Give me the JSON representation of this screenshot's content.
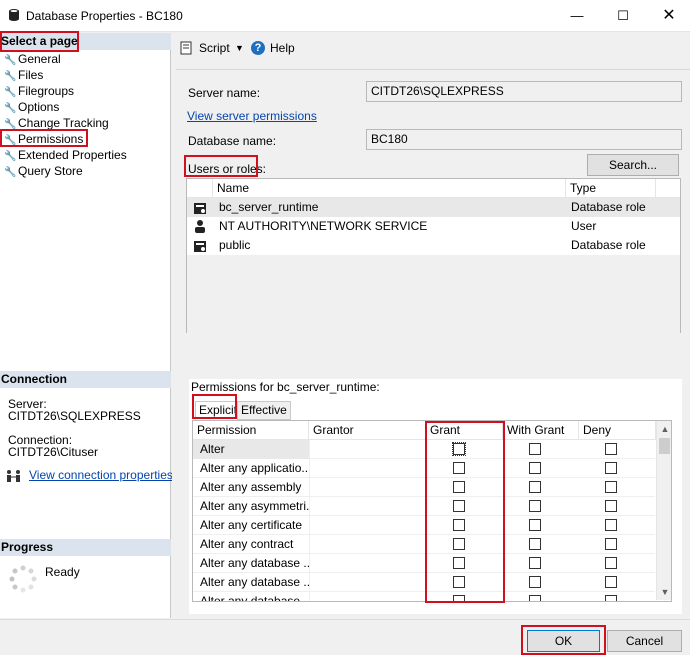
{
  "window": {
    "title": "Database Properties - BC180",
    "minimize": "—",
    "maximize": "☐",
    "close": "✕"
  },
  "left": {
    "select_page": "Select a page",
    "pages": [
      "General",
      "Files",
      "Filegroups",
      "Options",
      "Change Tracking",
      "Permissions",
      "Extended Properties",
      "Query Store"
    ],
    "connection_header": "Connection",
    "server_label": "Server:",
    "server_value": "CITDT26\\SQLEXPRESS",
    "connection_label": "Connection:",
    "connection_value": "CITDT26\\Cituser",
    "view_connection": "View connection properties",
    "progress_header": "Progress",
    "progress_status": "Ready"
  },
  "toolbar": {
    "script": "Script",
    "dropdown": "▼",
    "help": "Help"
  },
  "form": {
    "server_name_label": "Server name:",
    "server_name_value": "CITDT26\\SQLEXPRESS",
    "view_server_permissions": "View server permissions",
    "database_name_label": "Database name:",
    "database_name_value": "BC180",
    "users_or_roles_label": "Users or roles:",
    "search_button": "Search..."
  },
  "users": {
    "headers": [
      "Name",
      "Type"
    ],
    "rows": [
      {
        "name": "bc_server_runtime",
        "type": "Database role"
      },
      {
        "name": "NT AUTHORITY\\NETWORK SERVICE",
        "type": "User"
      },
      {
        "name": "public",
        "type": "Database role"
      }
    ]
  },
  "permissions": {
    "label": "Permissions for bc_server_runtime:",
    "tabs": [
      "Explicit",
      "Effective"
    ],
    "headers": [
      "Permission",
      "Grantor",
      "Grant",
      "With Grant",
      "Deny"
    ],
    "rows": [
      "Alter",
      "Alter any applicatio...",
      "Alter any assembly",
      "Alter any asymmetri...",
      "Alter any certificate",
      "Alter any contract",
      "Alter any database ...",
      "Alter any database ...",
      "Alter any database ..."
    ]
  },
  "buttons": {
    "ok": "OK",
    "cancel": "Cancel"
  }
}
